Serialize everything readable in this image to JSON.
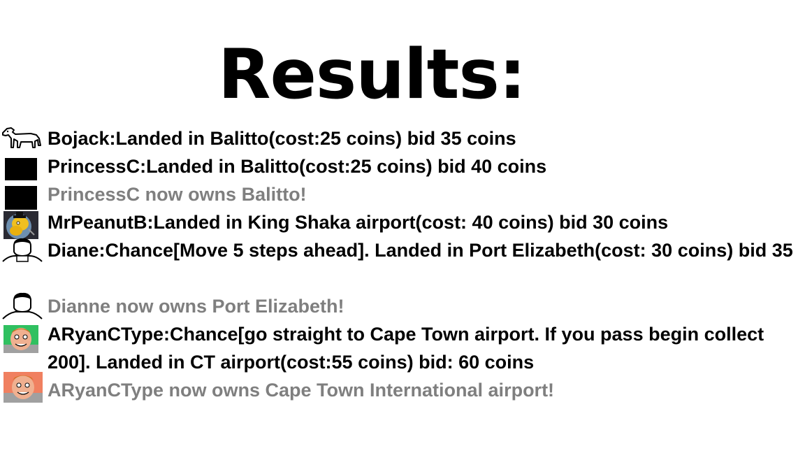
{
  "title": "Results:",
  "entries": [
    {
      "avatar": "horse-icon",
      "text": "Bojack:Landed in Balitto(cost:25 coins) bid 35 coins",
      "style": "normal"
    },
    {
      "avatar": "black-square-icon",
      "text": "PrincessC:Landed in Balitto(cost:25 coins) bid 40 coins",
      "style": "normal"
    },
    {
      "avatar": "black-square-icon",
      "text": "PrincessC now owns Balitto!",
      "style": "gray"
    },
    {
      "avatar": "peanut-icon",
      "text": "MrPeanutB:Landed in King Shaka airport(cost: 40 coins) bid 30 coins",
      "style": "normal"
    },
    {
      "avatar": "person-sketch-icon",
      "text": "Diane:Chance[Move 5 steps ahead]. Landed in Port Elizabeth(cost: 30 coins) bid 35",
      "style": "normal"
    },
    {
      "avatar": "person-sketch-icon",
      "text": "Dianne now owns Port Elizabeth!",
      "style": "gray"
    },
    {
      "avatar": "cartoon-face-icon",
      "text": "ARyanCType:Chance[go straight to Cape Town airport. If you pass begin collect 200]. Landed in CT airport(cost:55 coins) bid: 60 coins",
      "style": "normal"
    },
    {
      "avatar": "cartoon-face-icon",
      "text": "ARyanCType now owns Cape Town International airport!",
      "style": "gray"
    }
  ],
  "colors": {
    "text": "#000000",
    "ownership_text": "#7f7f7f",
    "background": "#ffffff"
  }
}
